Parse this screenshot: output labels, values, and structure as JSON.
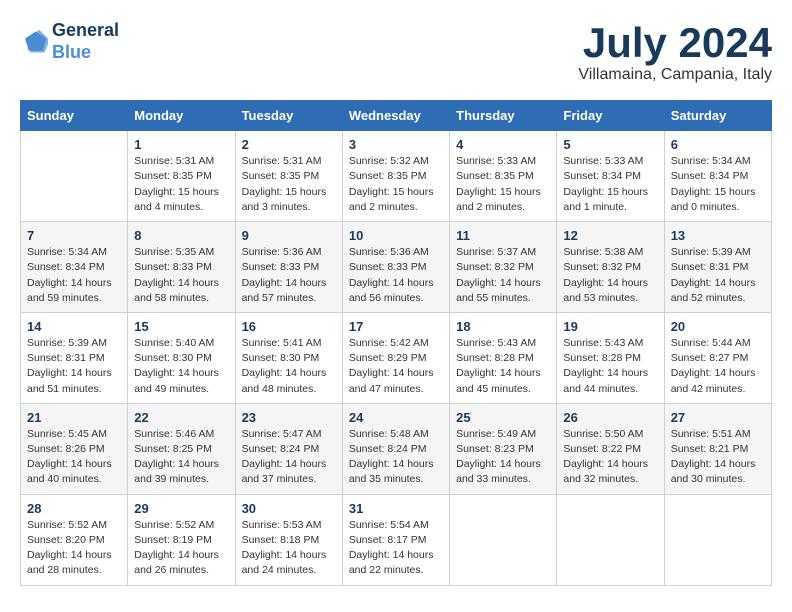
{
  "logo": {
    "line1": "General",
    "line2": "Blue"
  },
  "title": "July 2024",
  "subtitle": "Villamaina, Campania, Italy",
  "days_of_week": [
    "Sunday",
    "Monday",
    "Tuesday",
    "Wednesday",
    "Thursday",
    "Friday",
    "Saturday"
  ],
  "weeks": [
    [
      {
        "day": "",
        "info": ""
      },
      {
        "day": "1",
        "info": "Sunrise: 5:31 AM\nSunset: 8:35 PM\nDaylight: 15 hours\nand 4 minutes."
      },
      {
        "day": "2",
        "info": "Sunrise: 5:31 AM\nSunset: 8:35 PM\nDaylight: 15 hours\nand 3 minutes."
      },
      {
        "day": "3",
        "info": "Sunrise: 5:32 AM\nSunset: 8:35 PM\nDaylight: 15 hours\nand 2 minutes."
      },
      {
        "day": "4",
        "info": "Sunrise: 5:33 AM\nSunset: 8:35 PM\nDaylight: 15 hours\nand 2 minutes."
      },
      {
        "day": "5",
        "info": "Sunrise: 5:33 AM\nSunset: 8:34 PM\nDaylight: 15 hours\nand 1 minute."
      },
      {
        "day": "6",
        "info": "Sunrise: 5:34 AM\nSunset: 8:34 PM\nDaylight: 15 hours\nand 0 minutes."
      }
    ],
    [
      {
        "day": "7",
        "info": "Sunrise: 5:34 AM\nSunset: 8:34 PM\nDaylight: 14 hours\nand 59 minutes."
      },
      {
        "day": "8",
        "info": "Sunrise: 5:35 AM\nSunset: 8:33 PM\nDaylight: 14 hours\nand 58 minutes."
      },
      {
        "day": "9",
        "info": "Sunrise: 5:36 AM\nSunset: 8:33 PM\nDaylight: 14 hours\nand 57 minutes."
      },
      {
        "day": "10",
        "info": "Sunrise: 5:36 AM\nSunset: 8:33 PM\nDaylight: 14 hours\nand 56 minutes."
      },
      {
        "day": "11",
        "info": "Sunrise: 5:37 AM\nSunset: 8:32 PM\nDaylight: 14 hours\nand 55 minutes."
      },
      {
        "day": "12",
        "info": "Sunrise: 5:38 AM\nSunset: 8:32 PM\nDaylight: 14 hours\nand 53 minutes."
      },
      {
        "day": "13",
        "info": "Sunrise: 5:39 AM\nSunset: 8:31 PM\nDaylight: 14 hours\nand 52 minutes."
      }
    ],
    [
      {
        "day": "14",
        "info": "Sunrise: 5:39 AM\nSunset: 8:31 PM\nDaylight: 14 hours\nand 51 minutes."
      },
      {
        "day": "15",
        "info": "Sunrise: 5:40 AM\nSunset: 8:30 PM\nDaylight: 14 hours\nand 49 minutes."
      },
      {
        "day": "16",
        "info": "Sunrise: 5:41 AM\nSunset: 8:30 PM\nDaylight: 14 hours\nand 48 minutes."
      },
      {
        "day": "17",
        "info": "Sunrise: 5:42 AM\nSunset: 8:29 PM\nDaylight: 14 hours\nand 47 minutes."
      },
      {
        "day": "18",
        "info": "Sunrise: 5:43 AM\nSunset: 8:28 PM\nDaylight: 14 hours\nand 45 minutes."
      },
      {
        "day": "19",
        "info": "Sunrise: 5:43 AM\nSunset: 8:28 PM\nDaylight: 14 hours\nand 44 minutes."
      },
      {
        "day": "20",
        "info": "Sunrise: 5:44 AM\nSunset: 8:27 PM\nDaylight: 14 hours\nand 42 minutes."
      }
    ],
    [
      {
        "day": "21",
        "info": "Sunrise: 5:45 AM\nSunset: 8:26 PM\nDaylight: 14 hours\nand 40 minutes."
      },
      {
        "day": "22",
        "info": "Sunrise: 5:46 AM\nSunset: 8:25 PM\nDaylight: 14 hours\nand 39 minutes."
      },
      {
        "day": "23",
        "info": "Sunrise: 5:47 AM\nSunset: 8:24 PM\nDaylight: 14 hours\nand 37 minutes."
      },
      {
        "day": "24",
        "info": "Sunrise: 5:48 AM\nSunset: 8:24 PM\nDaylight: 14 hours\nand 35 minutes."
      },
      {
        "day": "25",
        "info": "Sunrise: 5:49 AM\nSunset: 8:23 PM\nDaylight: 14 hours\nand 33 minutes."
      },
      {
        "day": "26",
        "info": "Sunrise: 5:50 AM\nSunset: 8:22 PM\nDaylight: 14 hours\nand 32 minutes."
      },
      {
        "day": "27",
        "info": "Sunrise: 5:51 AM\nSunset: 8:21 PM\nDaylight: 14 hours\nand 30 minutes."
      }
    ],
    [
      {
        "day": "28",
        "info": "Sunrise: 5:52 AM\nSunset: 8:20 PM\nDaylight: 14 hours\nand 28 minutes."
      },
      {
        "day": "29",
        "info": "Sunrise: 5:52 AM\nSunset: 8:19 PM\nDaylight: 14 hours\nand 26 minutes."
      },
      {
        "day": "30",
        "info": "Sunrise: 5:53 AM\nSunset: 8:18 PM\nDaylight: 14 hours\nand 24 minutes."
      },
      {
        "day": "31",
        "info": "Sunrise: 5:54 AM\nSunset: 8:17 PM\nDaylight: 14 hours\nand 22 minutes."
      },
      {
        "day": "",
        "info": ""
      },
      {
        "day": "",
        "info": ""
      },
      {
        "day": "",
        "info": ""
      }
    ]
  ]
}
